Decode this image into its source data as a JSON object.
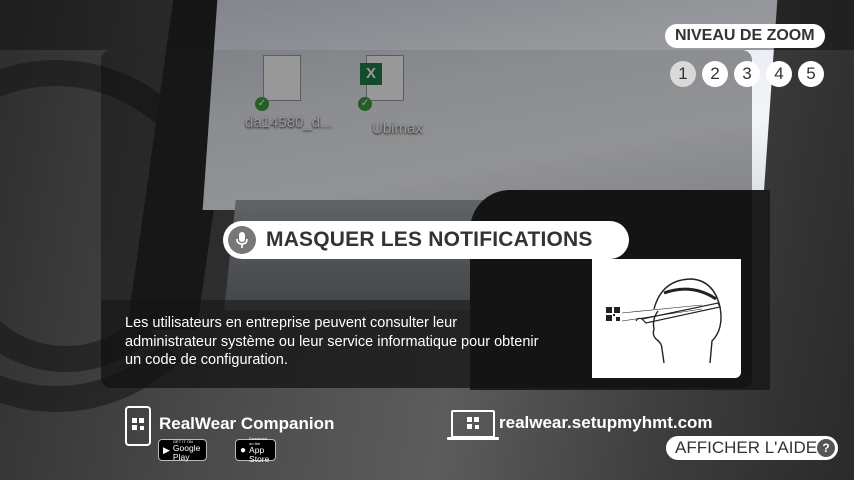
{
  "zoom": {
    "title": "NIVEAU DE ZOOM",
    "levels": [
      "1",
      "2",
      "3",
      "4",
      "5"
    ],
    "active_level": "1"
  },
  "desktop": {
    "icons": [
      {
        "label": "da14580_d...",
        "icon": "document-icon"
      },
      {
        "label": "Ubimax",
        "icon": "excel-file-icon"
      }
    ]
  },
  "command": {
    "label": "MASQUER LES NOTIFICATIONS",
    "icon": "microphone-icon"
  },
  "description": "Les utilisateurs en entreprise peuvent consulter leur administrateur système ou leur service informatique pour obtenir un code de configuration.",
  "companion": {
    "title": "RealWear Companion",
    "google_play": {
      "small": "GET IT ON",
      "big": "Google Play"
    },
    "app_store": {
      "small": "Download on the",
      "big": "App Store"
    }
  },
  "setup_url": "realwear.setupmyhmt.com",
  "help_button": {
    "label": "AFFICHER L'AIDE",
    "icon_text": "?"
  },
  "colors": {
    "pill_bg": "#ffffff",
    "text_dark": "#333333",
    "mic_bg": "#777777"
  }
}
